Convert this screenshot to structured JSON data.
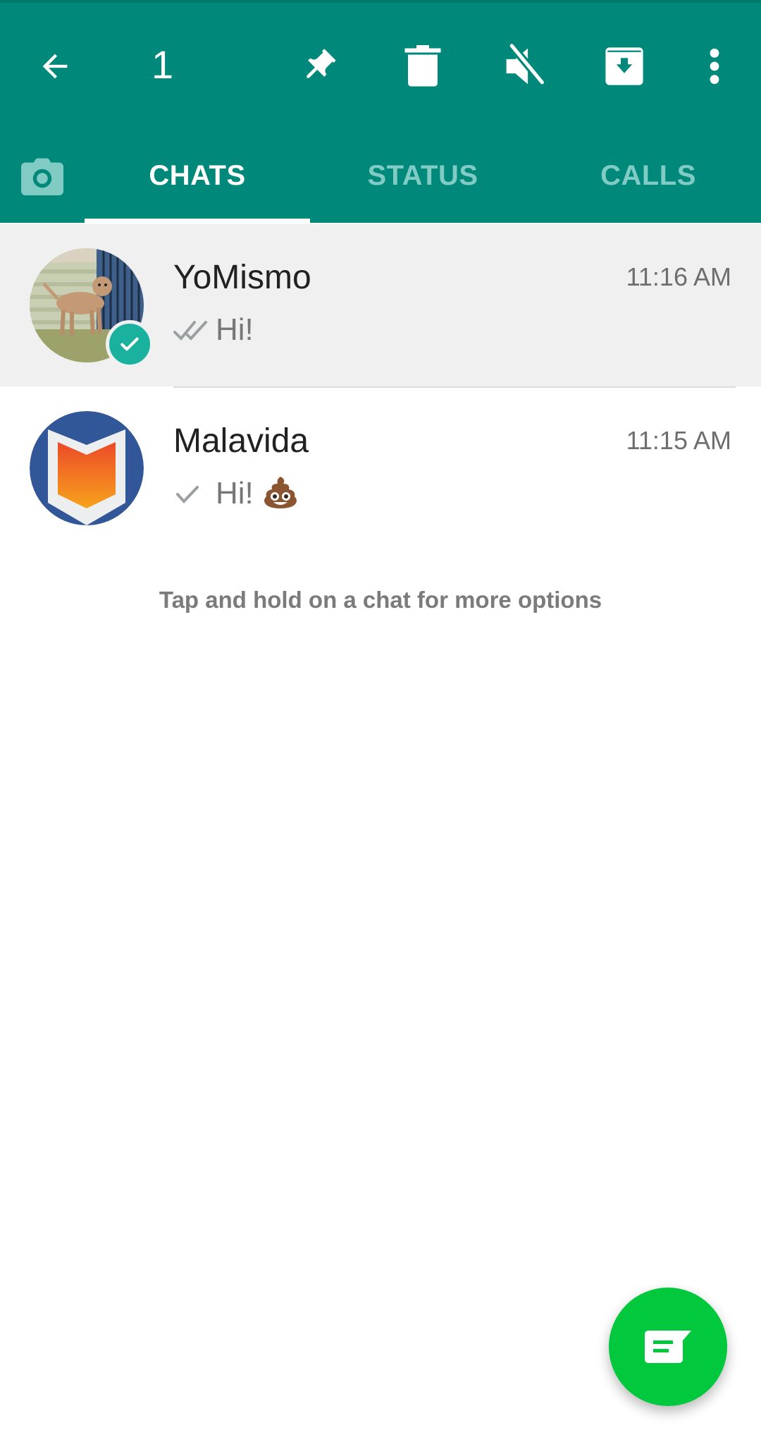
{
  "app_bar": {
    "selected_count": "1",
    "actions": {
      "back": "back-arrow-icon",
      "pin": "pin-icon",
      "delete": "trash-icon",
      "mute": "mute-icon",
      "archive": "archive-icon",
      "more": "more-vert-icon"
    }
  },
  "tabs": {
    "camera": "camera-icon",
    "items": [
      {
        "label": "CHATS",
        "active": true
      },
      {
        "label": "STATUS",
        "active": false
      },
      {
        "label": "CALLS",
        "active": false
      }
    ]
  },
  "chats": [
    {
      "name": "YoMismo",
      "time": "11:16 AM",
      "preview": "Hi!",
      "receipt": "double-check-icon",
      "selected": true,
      "avatar": "dog-photo"
    },
    {
      "name": "Malavida",
      "time": "11:15 AM",
      "preview": "Hi!",
      "emoji": "💩",
      "receipt": "single-check-icon",
      "selected": false,
      "avatar": "malavida-logo"
    }
  ],
  "hint": "Tap and hold on a chat for more options",
  "fab": {
    "icon": "new-chat-icon"
  },
  "colors": {
    "primary": "#00897b",
    "tab_inactive": "#80cbc4",
    "fab": "#02c83e",
    "selection_badge": "#1ab29f",
    "selected_row": "#f0f0f0"
  }
}
